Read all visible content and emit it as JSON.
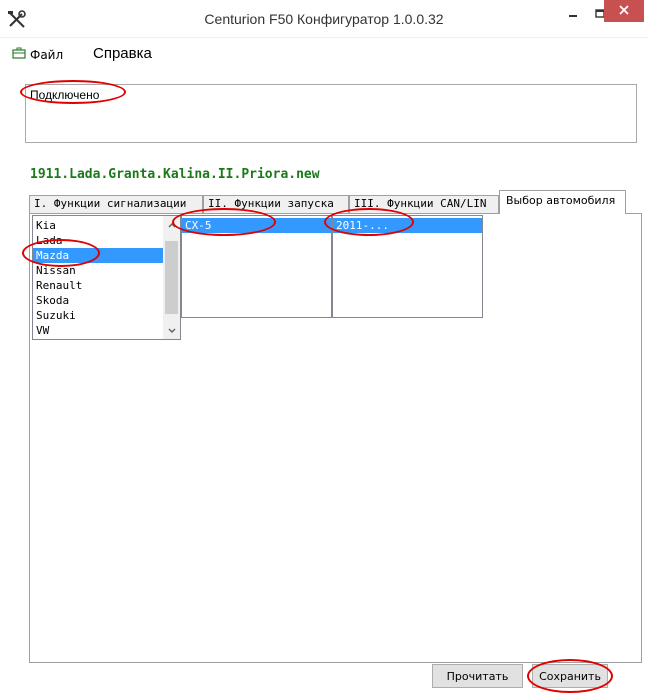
{
  "window": {
    "title": "Centurion F50 Конфигуратор 1.0.0.32",
    "close_color": "#c75050"
  },
  "menu": {
    "file_label": "Файл",
    "help_label": "Справка"
  },
  "status": {
    "text": "Подключено"
  },
  "config": {
    "name": "1911.Lada.Granta.Kalina.II.Priora.new",
    "name_color": "#1a7a1a"
  },
  "tabs": [
    {
      "label": "I. Функции сигнализации",
      "active": false
    },
    {
      "label": "II. Функции запуска",
      "active": false
    },
    {
      "label": "III. Функции CAN/LIN",
      "active": false
    },
    {
      "label": "Выбор автомобиля",
      "active": true
    }
  ],
  "car_select": {
    "brands": [
      "Kia",
      "Lada",
      "Mazda",
      "Nissan",
      "Renault",
      "Skoda",
      "Suzuki",
      "VW"
    ],
    "selected_brand": "Mazda",
    "models": [
      "CX-5"
    ],
    "selected_model": "CX-5",
    "years": [
      "2011-..."
    ],
    "selected_year": "2011-..."
  },
  "buttons": {
    "read_label": "Прочитать",
    "save_label": "Сохранить"
  },
  "colors": {
    "selection": "#3399ff",
    "annotation": "#e00000"
  }
}
